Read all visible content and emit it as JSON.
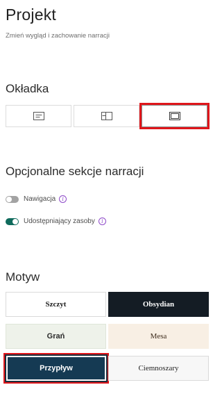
{
  "header": {
    "title": "Projekt",
    "subtitle": "Zmień wygląd i zachowanie narracji"
  },
  "cover": {
    "heading": "Okładka",
    "options": [
      {
        "icon": "cover-minimal-icon",
        "selected": false
      },
      {
        "icon": "cover-sidebar-icon",
        "selected": false
      },
      {
        "icon": "cover-full-icon",
        "selected": true
      }
    ]
  },
  "optional_sections": {
    "heading": "Opcjonalne sekcje narracji",
    "items": [
      {
        "label": "Nawigacja",
        "enabled": false
      },
      {
        "label": "Udostępniający zasoby",
        "enabled": true
      }
    ]
  },
  "theme": {
    "heading": "Motyw",
    "options": [
      {
        "label": "Szczyt"
      },
      {
        "label": "Obsydian"
      },
      {
        "label": "Grań"
      },
      {
        "label": "Mesa"
      },
      {
        "label": "Przypływ",
        "selected": true
      },
      {
        "label": "Ciemnoszary"
      }
    ]
  },
  "colors": {
    "highlight": "#e0161b",
    "toggle_on": "#0f6b5c",
    "toggle_off": "#a3a3a3",
    "info": "#8e4ac9"
  }
}
